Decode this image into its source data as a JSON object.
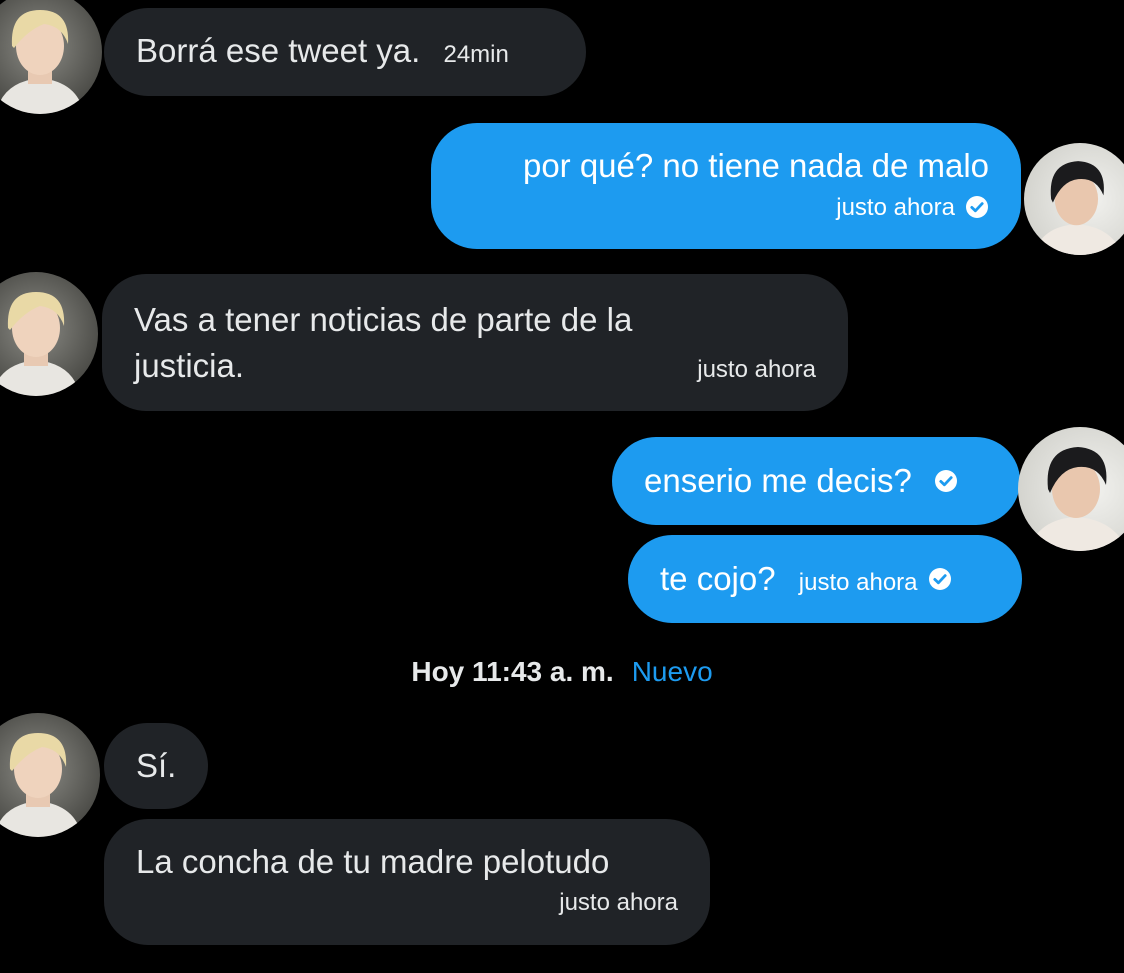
{
  "conversation": {
    "messages": [
      {
        "id": "m1",
        "direction": "received",
        "text": "Borrá ese tweet ya.",
        "time": "24min"
      },
      {
        "id": "m2",
        "direction": "sent",
        "text": "por qué? no tiene nada de malo",
        "time": "justo ahora",
        "status_icon": "check-circle-icon"
      },
      {
        "id": "m3",
        "direction": "received",
        "text_line1": "Vas a tener noticias de parte de la",
        "text_line2": "justicia.",
        "time": "justo ahora"
      },
      {
        "id": "m4",
        "direction": "sent",
        "text": "enserio me decis?",
        "status_icon": "check-circle-icon"
      },
      {
        "id": "m5",
        "direction": "sent",
        "text": "te cojo?",
        "time": "justo ahora",
        "status_icon": "check-circle-icon"
      },
      {
        "id": "m6",
        "direction": "received",
        "text": "Sí."
      },
      {
        "id": "m7",
        "direction": "received",
        "text": "La concha de tu madre pelotudo",
        "time": "justo ahora"
      }
    ],
    "divider": {
      "time": "Hoy 11:43 a. m.",
      "label": "Nuevo"
    }
  },
  "colors": {
    "background": "#000000",
    "received_bubble": "#202327",
    "sent_bubble": "#1d9bf0",
    "accent": "#1d9bf0",
    "text": "#e7e9ea"
  }
}
